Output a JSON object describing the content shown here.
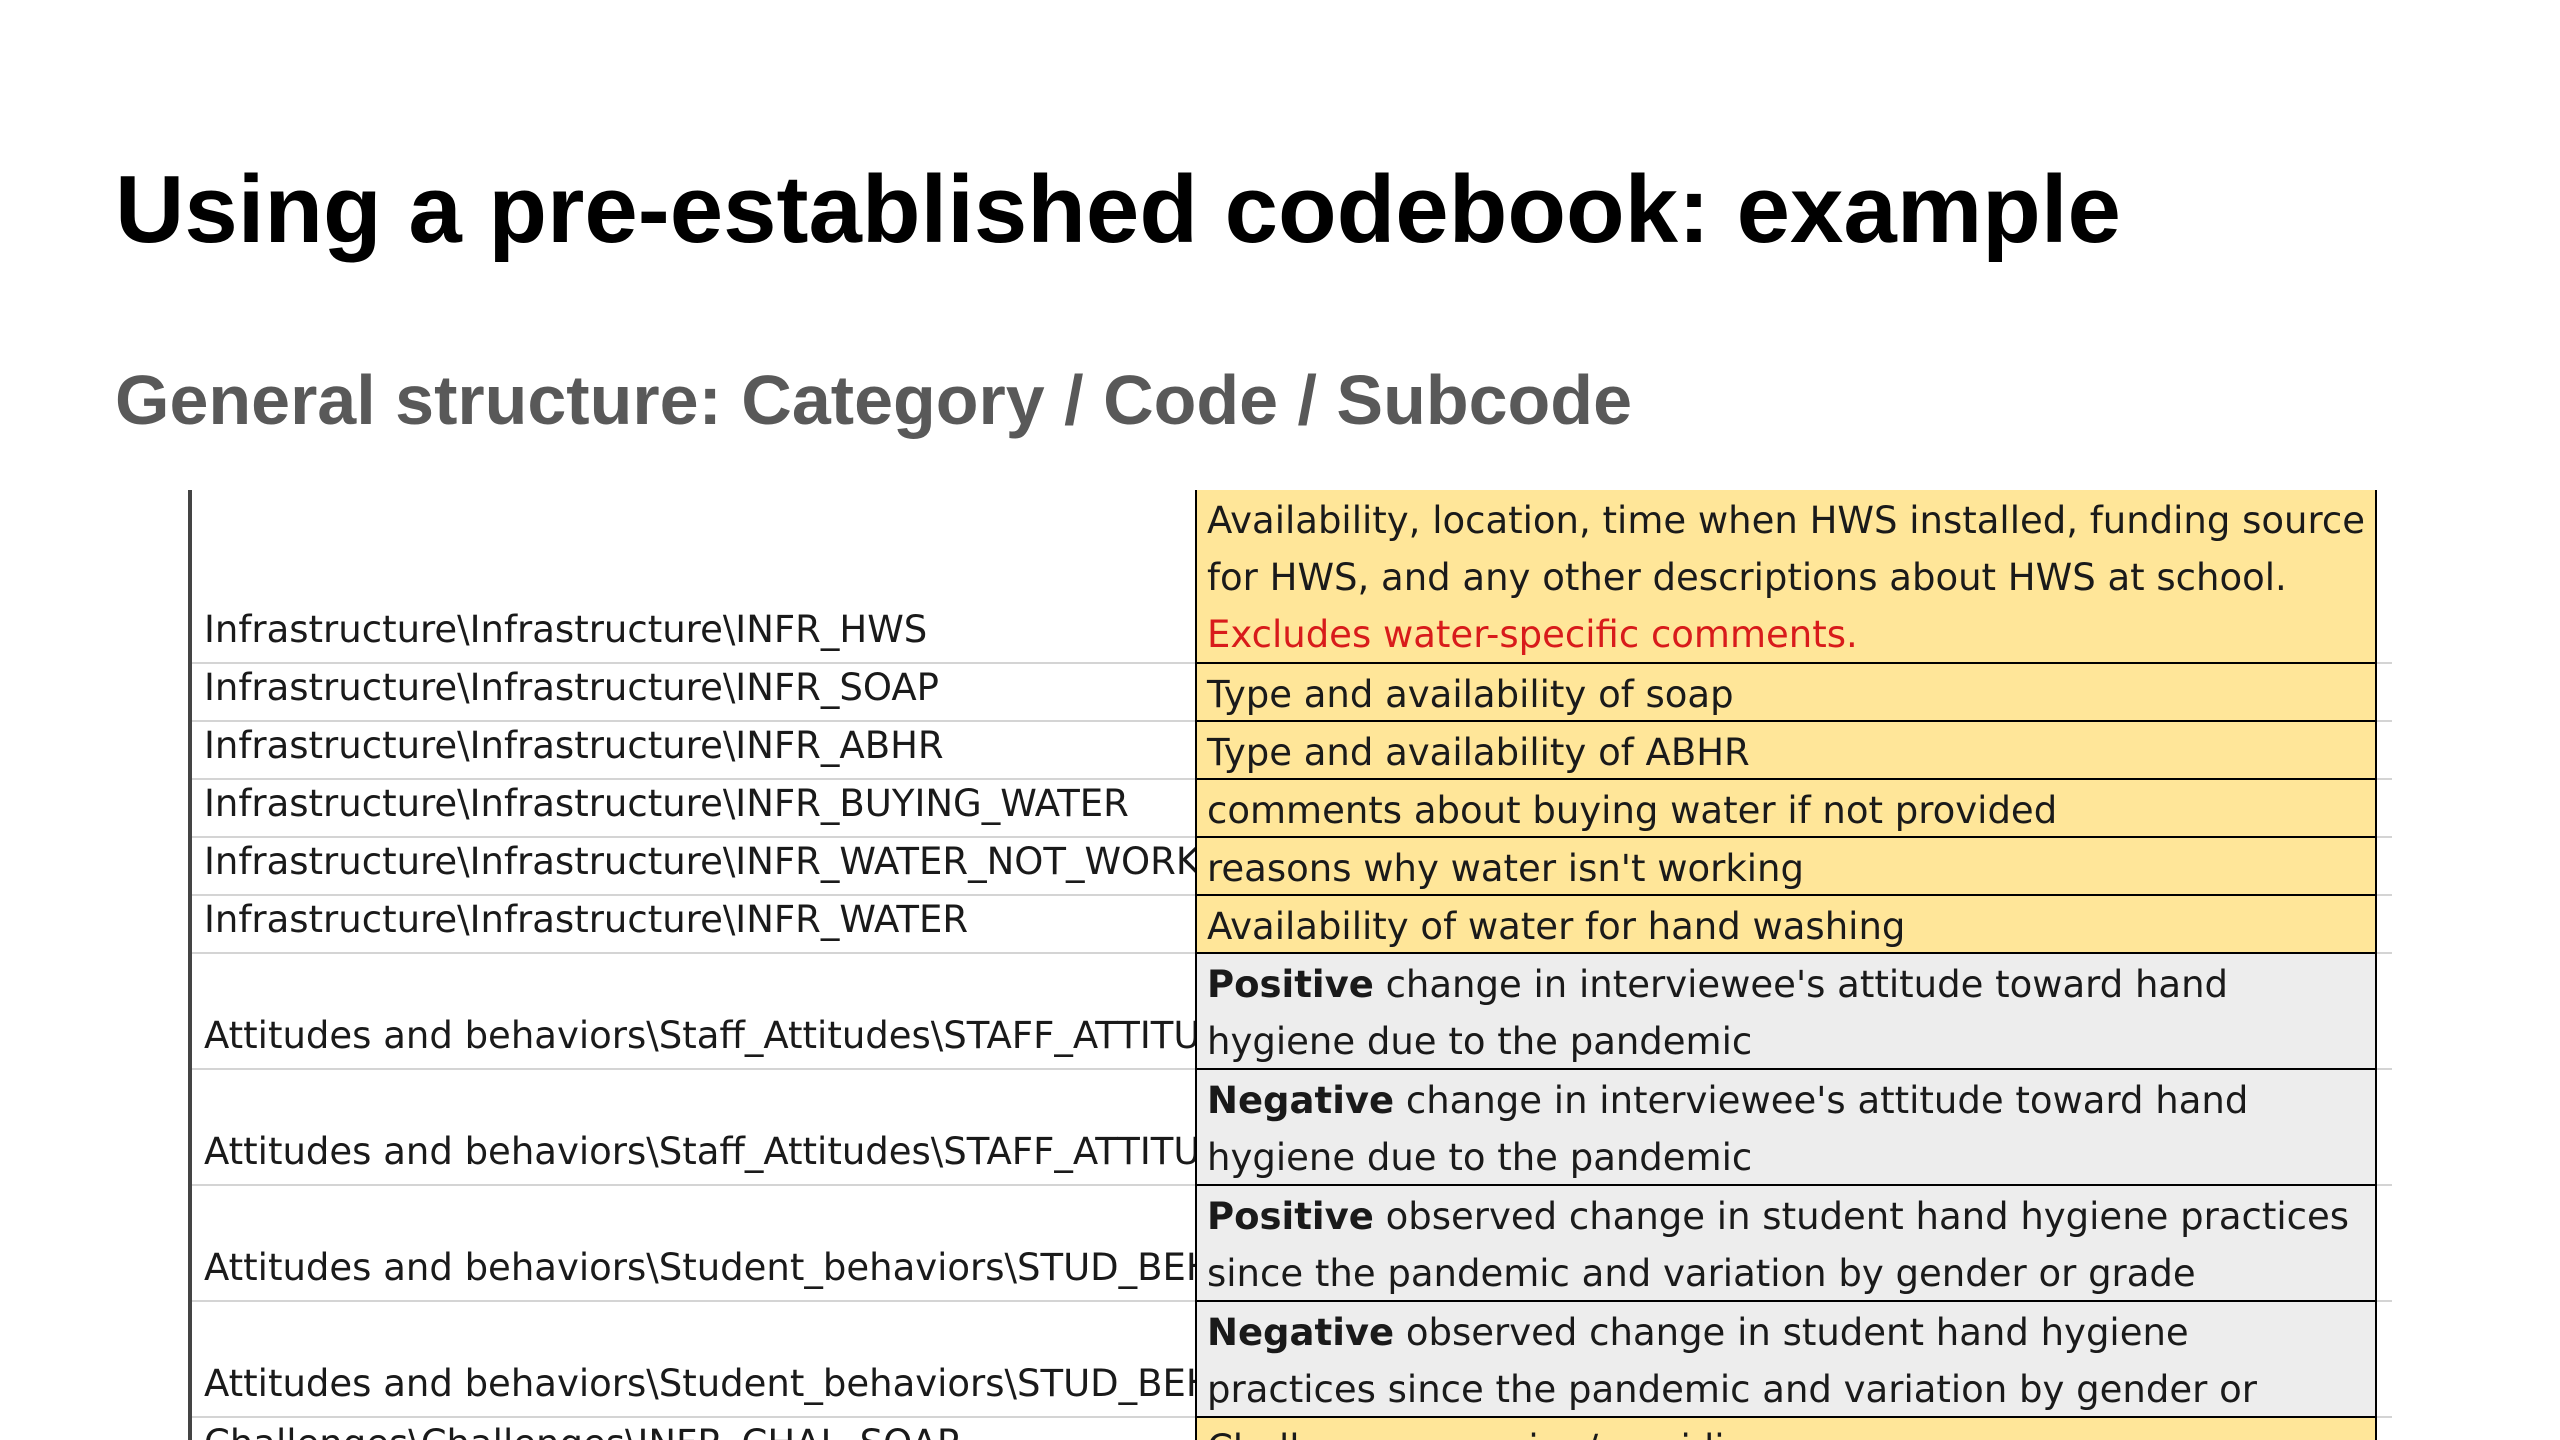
{
  "slide": {
    "title": "Using a pre-established codebook: example",
    "subtitle": "General structure: Category / Code / Subcode"
  },
  "codebook": {
    "rows": [
      {
        "path": "Infrastructure\\Infrastructure\\INFR_HWS",
        "lead": "",
        "text": "Availability, location, time when HWS installed, funding source for HWS, and any other descriptions about HWS at school. ",
        "note": "Excludes water-specific comments.",
        "fill": "yellow"
      },
      {
        "path": "Infrastructure\\Infrastructure\\INFR_SOAP",
        "lead": "",
        "text": "Type and availability of soap",
        "note": "",
        "fill": "yellow"
      },
      {
        "path": "Infrastructure\\Infrastructure\\INFR_ABHR",
        "lead": "",
        "text": "Type and availability of ABHR",
        "note": "",
        "fill": "yellow"
      },
      {
        "path": "Infrastructure\\Infrastructure\\INFR_BUYING_WATER",
        "lead": "",
        "text": "comments about buying water if not provided",
        "note": "",
        "fill": "yellow"
      },
      {
        "path": "Infrastructure\\Infrastructure\\INFR_WATER_NOT_WORKING",
        "lead": "",
        "text": "reasons why water isn't working",
        "note": "",
        "fill": "yellow"
      },
      {
        "path": "Infrastructure\\Infrastructure\\INFR_WATER",
        "lead": "",
        "text": "Availability of water for hand washing",
        "note": "",
        "fill": "yellow"
      },
      {
        "path": "Attitudes and behaviors\\Staff_Attitudes\\STAFF_ATTITUDE",
        "lead": "Positive",
        "text": " change in interviewee's attitude toward hand hygiene due to the pandemic",
        "note": "",
        "fill": "grey"
      },
      {
        "path": "Attitudes and behaviors\\Staff_Attitudes\\STAFF_ATTITUDE",
        "lead": "Negative",
        "text": " change in interviewee's attitude toward hand hygiene due to the pandemic",
        "note": "",
        "fill": "grey"
      },
      {
        "path": "Attitudes and behaviors\\Student_behaviors\\STUD_BEHAV",
        "lead": "Positive",
        "text": " observed change in student hand hygiene practices since the pandemic and variation by gender or grade",
        "note": "",
        "fill": "grey"
      },
      {
        "path": "Attitudes and behaviors\\Student_behaviors\\STUD_BEHAV",
        "lead": "Negative",
        "text": " observed change in student hand hygiene practices since the pandemic and variation by gender or grade",
        "note": "",
        "fill": "grey"
      },
      {
        "path": "Challenges\\Challenges\\INFR_CHAL_SOAP",
        "lead": "",
        "text": "Challenge accessing/providing soap",
        "note": "",
        "fill": "yellow"
      }
    ]
  }
}
